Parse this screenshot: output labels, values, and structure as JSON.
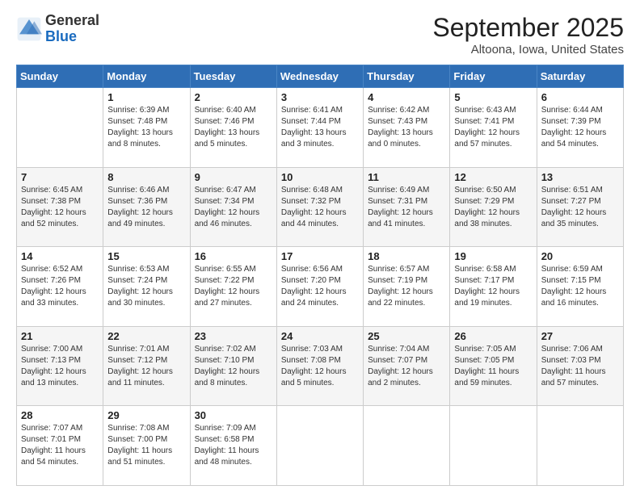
{
  "logo": {
    "general": "General",
    "blue": "Blue"
  },
  "header": {
    "title": "September 2025",
    "subtitle": "Altoona, Iowa, United States"
  },
  "weekdays": [
    "Sunday",
    "Monday",
    "Tuesday",
    "Wednesday",
    "Thursday",
    "Friday",
    "Saturday"
  ],
  "weeks": [
    [
      {
        "day": "",
        "info": ""
      },
      {
        "day": "1",
        "info": "Sunrise: 6:39 AM\nSunset: 7:48 PM\nDaylight: 13 hours\nand 8 minutes."
      },
      {
        "day": "2",
        "info": "Sunrise: 6:40 AM\nSunset: 7:46 PM\nDaylight: 13 hours\nand 5 minutes."
      },
      {
        "day": "3",
        "info": "Sunrise: 6:41 AM\nSunset: 7:44 PM\nDaylight: 13 hours\nand 3 minutes."
      },
      {
        "day": "4",
        "info": "Sunrise: 6:42 AM\nSunset: 7:43 PM\nDaylight: 13 hours\nand 0 minutes."
      },
      {
        "day": "5",
        "info": "Sunrise: 6:43 AM\nSunset: 7:41 PM\nDaylight: 12 hours\nand 57 minutes."
      },
      {
        "day": "6",
        "info": "Sunrise: 6:44 AM\nSunset: 7:39 PM\nDaylight: 12 hours\nand 54 minutes."
      }
    ],
    [
      {
        "day": "7",
        "info": "Sunrise: 6:45 AM\nSunset: 7:38 PM\nDaylight: 12 hours\nand 52 minutes."
      },
      {
        "day": "8",
        "info": "Sunrise: 6:46 AM\nSunset: 7:36 PM\nDaylight: 12 hours\nand 49 minutes."
      },
      {
        "day": "9",
        "info": "Sunrise: 6:47 AM\nSunset: 7:34 PM\nDaylight: 12 hours\nand 46 minutes."
      },
      {
        "day": "10",
        "info": "Sunrise: 6:48 AM\nSunset: 7:32 PM\nDaylight: 12 hours\nand 44 minutes."
      },
      {
        "day": "11",
        "info": "Sunrise: 6:49 AM\nSunset: 7:31 PM\nDaylight: 12 hours\nand 41 minutes."
      },
      {
        "day": "12",
        "info": "Sunrise: 6:50 AM\nSunset: 7:29 PM\nDaylight: 12 hours\nand 38 minutes."
      },
      {
        "day": "13",
        "info": "Sunrise: 6:51 AM\nSunset: 7:27 PM\nDaylight: 12 hours\nand 35 minutes."
      }
    ],
    [
      {
        "day": "14",
        "info": "Sunrise: 6:52 AM\nSunset: 7:26 PM\nDaylight: 12 hours\nand 33 minutes."
      },
      {
        "day": "15",
        "info": "Sunrise: 6:53 AM\nSunset: 7:24 PM\nDaylight: 12 hours\nand 30 minutes."
      },
      {
        "day": "16",
        "info": "Sunrise: 6:55 AM\nSunset: 7:22 PM\nDaylight: 12 hours\nand 27 minutes."
      },
      {
        "day": "17",
        "info": "Sunrise: 6:56 AM\nSunset: 7:20 PM\nDaylight: 12 hours\nand 24 minutes."
      },
      {
        "day": "18",
        "info": "Sunrise: 6:57 AM\nSunset: 7:19 PM\nDaylight: 12 hours\nand 22 minutes."
      },
      {
        "day": "19",
        "info": "Sunrise: 6:58 AM\nSunset: 7:17 PM\nDaylight: 12 hours\nand 19 minutes."
      },
      {
        "day": "20",
        "info": "Sunrise: 6:59 AM\nSunset: 7:15 PM\nDaylight: 12 hours\nand 16 minutes."
      }
    ],
    [
      {
        "day": "21",
        "info": "Sunrise: 7:00 AM\nSunset: 7:13 PM\nDaylight: 12 hours\nand 13 minutes."
      },
      {
        "day": "22",
        "info": "Sunrise: 7:01 AM\nSunset: 7:12 PM\nDaylight: 12 hours\nand 11 minutes."
      },
      {
        "day": "23",
        "info": "Sunrise: 7:02 AM\nSunset: 7:10 PM\nDaylight: 12 hours\nand 8 minutes."
      },
      {
        "day": "24",
        "info": "Sunrise: 7:03 AM\nSunset: 7:08 PM\nDaylight: 12 hours\nand 5 minutes."
      },
      {
        "day": "25",
        "info": "Sunrise: 7:04 AM\nSunset: 7:07 PM\nDaylight: 12 hours\nand 2 minutes."
      },
      {
        "day": "26",
        "info": "Sunrise: 7:05 AM\nSunset: 7:05 PM\nDaylight: 11 hours\nand 59 minutes."
      },
      {
        "day": "27",
        "info": "Sunrise: 7:06 AM\nSunset: 7:03 PM\nDaylight: 11 hours\nand 57 minutes."
      }
    ],
    [
      {
        "day": "28",
        "info": "Sunrise: 7:07 AM\nSunset: 7:01 PM\nDaylight: 11 hours\nand 54 minutes."
      },
      {
        "day": "29",
        "info": "Sunrise: 7:08 AM\nSunset: 7:00 PM\nDaylight: 11 hours\nand 51 minutes."
      },
      {
        "day": "30",
        "info": "Sunrise: 7:09 AM\nSunset: 6:58 PM\nDaylight: 11 hours\nand 48 minutes."
      },
      {
        "day": "",
        "info": ""
      },
      {
        "day": "",
        "info": ""
      },
      {
        "day": "",
        "info": ""
      },
      {
        "day": "",
        "info": ""
      }
    ]
  ]
}
